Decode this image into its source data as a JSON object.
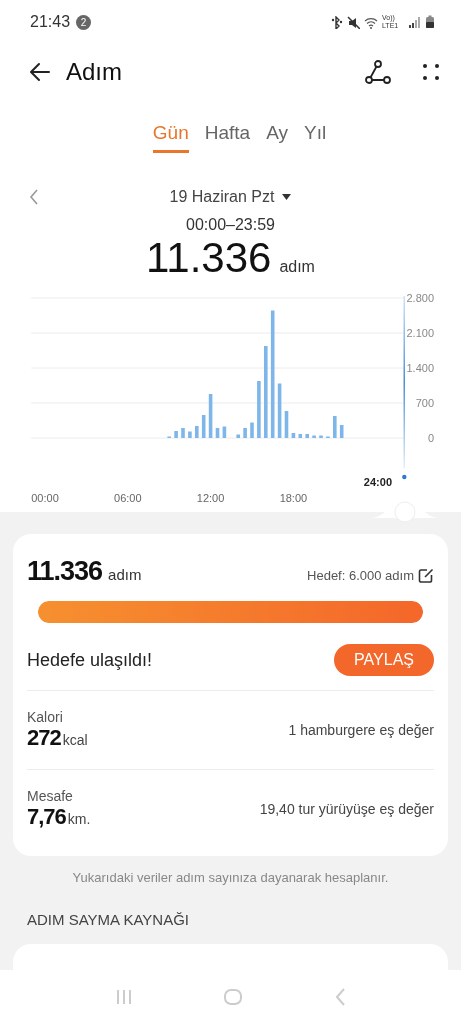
{
  "status_bar": {
    "time": "21:43",
    "notification_count": "2",
    "network_label": "Vo)) LTE1"
  },
  "app_bar": {
    "title": "Adım"
  },
  "tabs": [
    {
      "label": "Gün",
      "selected": true
    },
    {
      "label": "Hafta",
      "selected": false
    },
    {
      "label": "Ay",
      "selected": false
    },
    {
      "label": "Yıl",
      "selected": false
    }
  ],
  "date": {
    "label": "19 Haziran Pzt",
    "range": "00:00–23:59"
  },
  "total": {
    "value": "11.336",
    "unit": "adım"
  },
  "chart": {
    "now_label": "24:00",
    "chart_data": {
      "type": "bar",
      "grid": true,
      "x": [
        9,
        9.5,
        10,
        10.5,
        11,
        11.5,
        12,
        12.5,
        13,
        13.5,
        14,
        14.5,
        15,
        15.5,
        16,
        16.5,
        17,
        17.5,
        18,
        18.5,
        19,
        19.5,
        20,
        20.5,
        21,
        21.5
      ],
      "values": [
        20,
        140,
        200,
        130,
        240,
        460,
        880,
        200,
        230,
        null,
        70,
        200,
        310,
        1140,
        1840,
        2550,
        1090,
        540,
        100,
        80,
        80,
        50,
        50,
        20,
        440,
        260
      ],
      "ylim": [
        0,
        2800
      ],
      "xlim": [
        -1,
        26
      ],
      "yticks": [
        {
          "value": 0,
          "label": "0"
        },
        {
          "value": 700,
          "label": "700"
        },
        {
          "value": 1400,
          "label": "1.400"
        },
        {
          "value": 2100,
          "label": "2.100"
        },
        {
          "value": 2800,
          "label": "2.800"
        }
      ],
      "xticks": [
        {
          "value": 0,
          "label": "00:00"
        },
        {
          "value": 6,
          "label": "06:00"
        },
        {
          "value": 12,
          "label": "12:00"
        },
        {
          "value": 18,
          "label": "18:00"
        }
      ]
    }
  },
  "summary": {
    "value": "11.336",
    "unit": "adım",
    "goal": "Hedef: 6.000 adım",
    "level": 1,
    "goal_message": "Hedefe ulaşıldı!",
    "share_button": "PAYLAŞ",
    "metrics": [
      {
        "label": "Kalori",
        "value": "272",
        "unit": "kcal",
        "equivalent": "1 hamburgere eş değer"
      },
      {
        "label": "Mesafe",
        "value": "7,76",
        "unit": "km.",
        "equivalent": "19,40 tur yürüyüşe eş değer"
      }
    ]
  },
  "note": "Yukarıdaki veriler adım sayınıza dayanarak hesaplanır.",
  "section_title": "ADIM SAYMA KAYNAĞI"
}
